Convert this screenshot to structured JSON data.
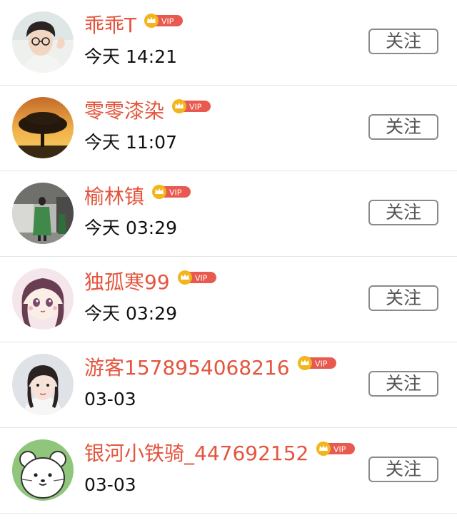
{
  "follow_list": [
    {
      "name": "乖乖T",
      "time": "今天 14:21",
      "badge": "VIP",
      "button": "关注",
      "avatar": "young-man-glasses"
    },
    {
      "name": "零零漆染",
      "time": "今天 11:07",
      "badge": "VIP",
      "button": "关注",
      "avatar": "sunset-tree"
    },
    {
      "name": "榆林镇",
      "time": "今天 03:29",
      "badge": "VIP",
      "button": "关注",
      "avatar": "person-green-coat"
    },
    {
      "name": "独孤寒99",
      "time": "今天 03:29",
      "badge": "VIP",
      "button": "关注",
      "avatar": "anime-girl"
    },
    {
      "name": "游客1578954068216",
      "time": "03-03",
      "badge": "VIP",
      "button": "关注",
      "avatar": "young-woman-selfie"
    },
    {
      "name": "银河小铁骑_447692152",
      "time": "03-03",
      "badge": "VIP",
      "button": "关注",
      "avatar": "cartoon-white-cat"
    }
  ],
  "colors": {
    "name": "#e4553d",
    "vip_badge": "#e85a4f",
    "crown": "#f2b51c",
    "divider": "#e6e6e6",
    "button_border": "#8a8a8a"
  }
}
